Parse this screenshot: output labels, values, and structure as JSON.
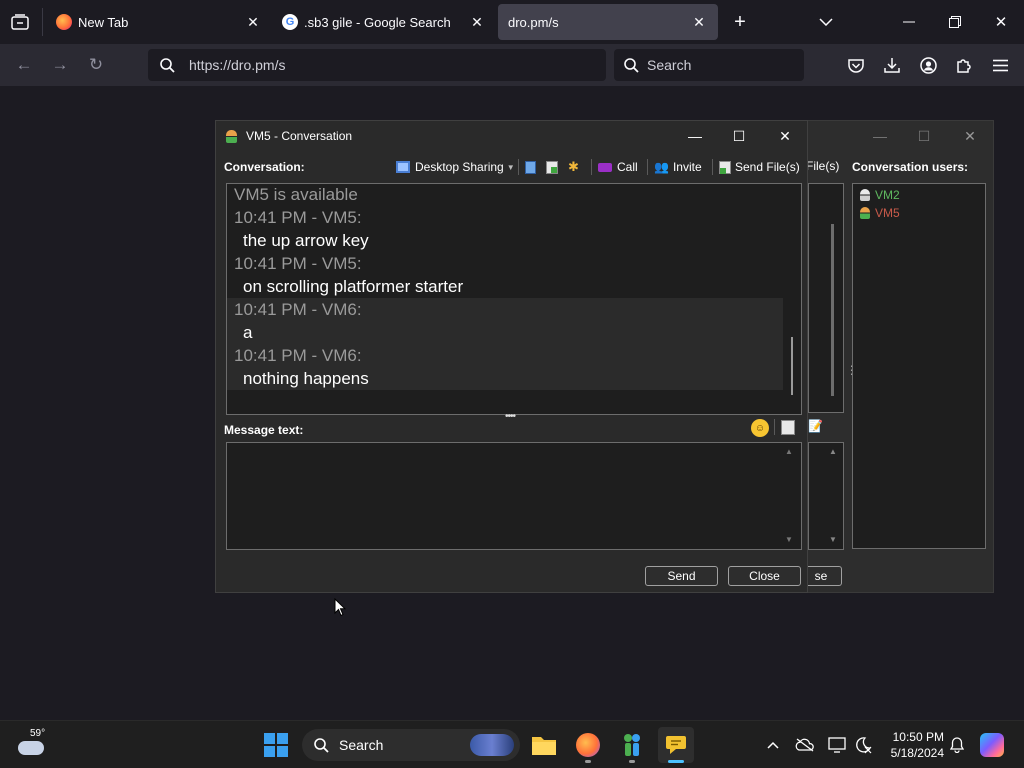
{
  "browser": {
    "tabs": [
      {
        "label": "New Tab",
        "active": false
      },
      {
        "label": ".sb3 gile - Google Search",
        "active": false
      },
      {
        "label": "dro.pm/s",
        "active": true
      }
    ],
    "url": "https://dro.pm/s",
    "search_placeholder": "Search"
  },
  "conversation_window": {
    "title": "VM5 - Conversation",
    "conversation_label": "Conversation:",
    "toolbar": {
      "desktop_sharing": "Desktop Sharing",
      "call": "Call",
      "invite": "Invite",
      "send_files": "Send File(s)"
    },
    "messages": [
      {
        "meta": "VM5 is available",
        "text": ""
      },
      {
        "meta": "10:41 PM - VM5:",
        "text": "the up arrow key"
      },
      {
        "meta": "10:41 PM - VM5:",
        "text": "on scrolling platformer starter"
      },
      {
        "meta": "10:41 PM - VM6:",
        "text": "a"
      },
      {
        "meta": "10:41 PM - VM6:",
        "text": "nothing happens"
      }
    ],
    "message_text_label": "Message text:",
    "message_value": "",
    "send_button": "Send",
    "close_button": "Close"
  },
  "back_window": {
    "send_files_partial": "File(s)",
    "conversation_users_label": "Conversation users:",
    "users": [
      {
        "name": "VM2",
        "color": "#5fb85f"
      },
      {
        "name": "VM5",
        "color": "#c85a4a"
      }
    ],
    "close_partial": "se"
  },
  "taskbar": {
    "weather_temp": "59°",
    "search_label": "Search",
    "time": "10:50 PM",
    "date": "5/18/2024"
  },
  "colors": {
    "accent_blue": "#0078d4",
    "firefox_orange": "#ff7139",
    "active_tab": "#42414d"
  }
}
